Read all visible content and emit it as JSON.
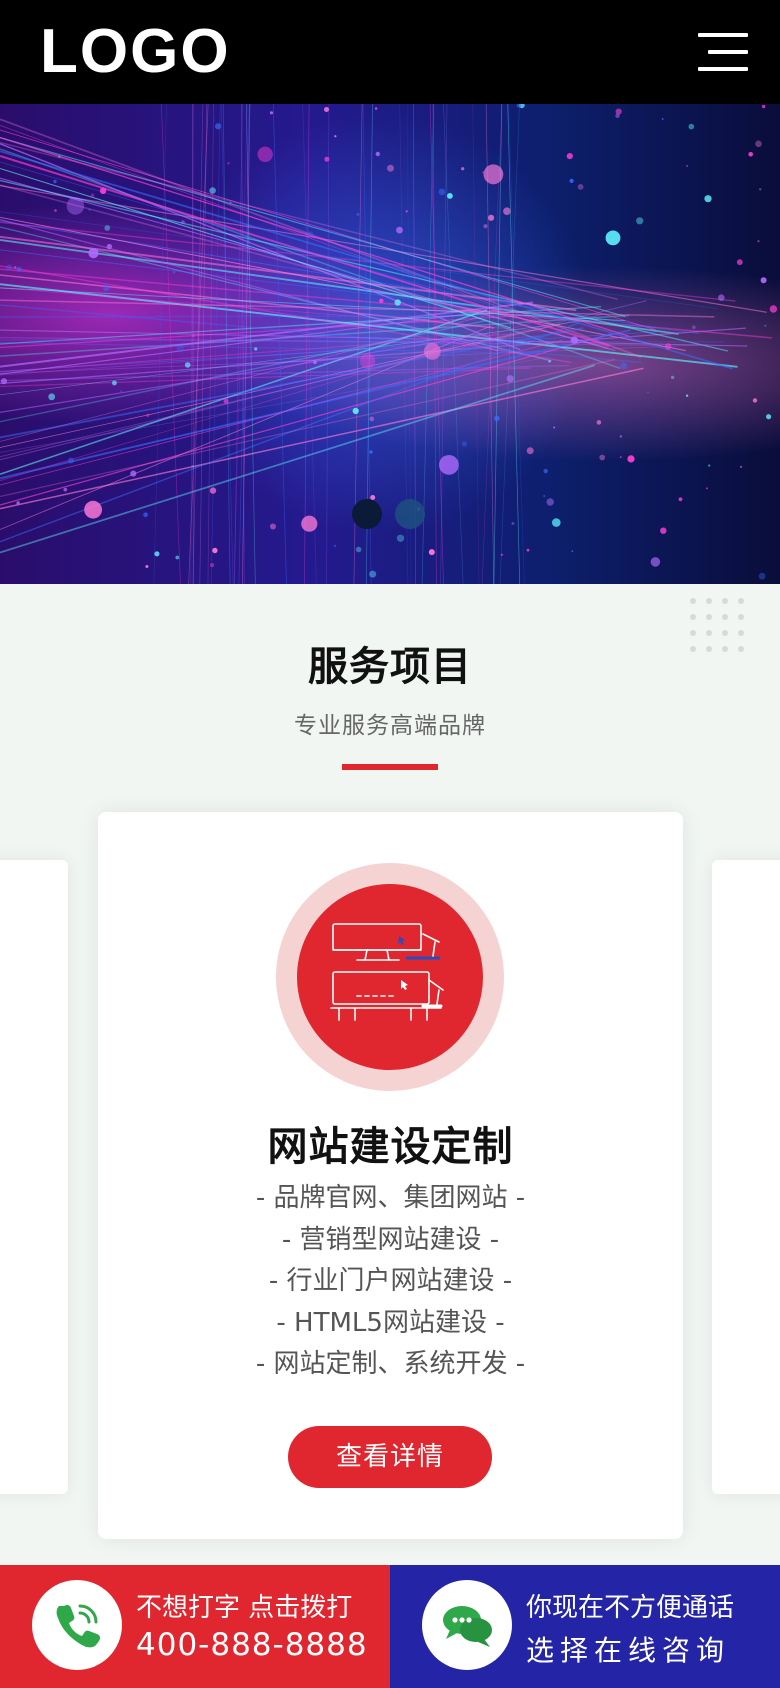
{
  "header": {
    "logo_text": "LOGO",
    "menu_icon": "hamburger-menu-icon"
  },
  "banner": {
    "slide_count": 2,
    "active_slide": 1,
    "colors": {
      "magenta": "#ff3fd8",
      "blue": "#3a6bff",
      "cyan": "#5ff3ff",
      "deep": "#0a0d3a"
    }
  },
  "services": {
    "title": "服务项目",
    "subtitle": "专业服务高端品牌",
    "accent_color": "#e0272f",
    "card": {
      "icon": "computer-monitor-icon",
      "title": "网站建设定制",
      "items": [
        "- 品牌官网、集团网站 -",
        "- 营销型网站建设 -",
        "- 行业门户网站建设 -",
        "- HTML5网站建设 -",
        "- 网站定制、系统开发 -"
      ],
      "button_label": "查看详情"
    }
  },
  "bottom_bar": {
    "call": {
      "icon": "phone-icon",
      "line1": "不想打字 点击拨打",
      "line2": "400-888-8888",
      "color": "#e0272f"
    },
    "chat": {
      "icon": "chat-bubbles-icon",
      "line1": "你现在不方便通话",
      "line2": "选择在线咨询",
      "color": "#2424a6"
    }
  }
}
